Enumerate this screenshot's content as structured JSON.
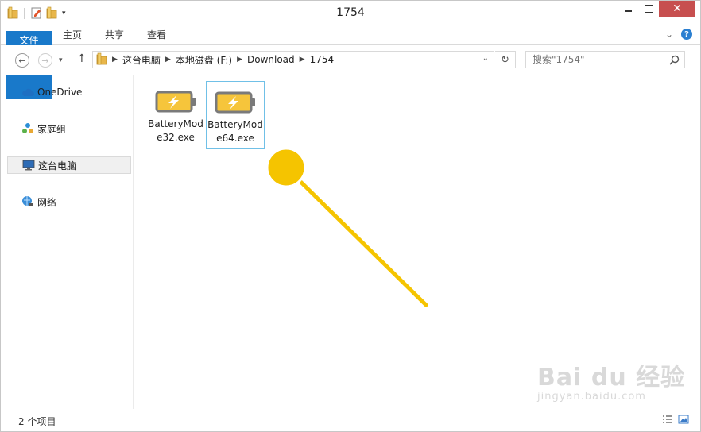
{
  "window": {
    "title": "1754"
  },
  "ribbon": {
    "tabs": [
      {
        "label": "文件"
      },
      {
        "label": "主页"
      },
      {
        "label": "共享"
      },
      {
        "label": "查看"
      }
    ]
  },
  "address": {
    "crumbs": [
      "这台电脑",
      "本地磁盘 (F:)",
      "Download",
      "1754"
    ]
  },
  "search": {
    "placeholder": "搜索\"1754\""
  },
  "navpane": {
    "items": [
      {
        "label": "OneDrive",
        "icon": "cloud-icon"
      },
      {
        "label": "家庭组",
        "icon": "homegroup-icon"
      },
      {
        "label": "这台电脑",
        "icon": "computer-icon",
        "selected": true
      },
      {
        "label": "网络",
        "icon": "network-icon"
      }
    ]
  },
  "files": [
    {
      "name": "BatteryMode32.exe",
      "icon": "battery-app-icon",
      "selected": false
    },
    {
      "name": "BatteryMode64.exe",
      "icon": "battery-app-icon",
      "selected": true
    }
  ],
  "status": {
    "item_count": "2 个项目"
  },
  "watermark": {
    "brand": "Bai du 经验",
    "url": "jingyan.baidu.com"
  },
  "colors": {
    "accent": "#1979ca",
    "pointer": "#f5c400",
    "close": "#c74f4f"
  }
}
